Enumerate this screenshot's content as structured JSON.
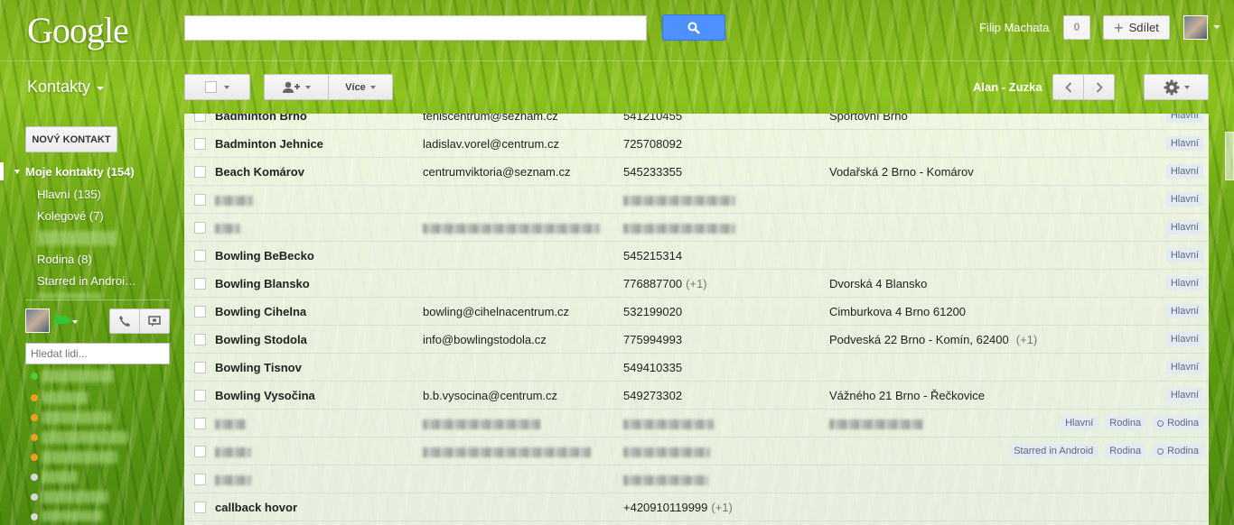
{
  "header": {
    "logo": "Google",
    "user_name": "Filip Machata",
    "notifications": "0",
    "share_label": "Sdílet"
  },
  "app": {
    "title": "Kontakty"
  },
  "toolbar": {
    "more_label": "Více",
    "range_label": "Alan - Zuzka"
  },
  "sidebar": {
    "new_contact": "NOVÝ KONTAKT",
    "my_contacts": "Moje kontakty (154)",
    "groups": [
      "Hlavní (135)",
      "Kolegové (7)",
      "Rodina (8)",
      "Starred in Androi…"
    ],
    "people_search_placeholder": "Hledat lidi..."
  },
  "contacts": [
    {
      "name": "Badminton Brno",
      "email": "teniscentrum@seznam.cz",
      "phone": "541210455",
      "phone_extra": "",
      "address": "Sportovní Brno",
      "address_extra": "",
      "tags": [
        "Hlavní"
      ],
      "blurred": false
    },
    {
      "name": "Badminton Jehnice",
      "email": "ladislav.vorel@centrum.cz",
      "phone": "725708092",
      "phone_extra": "",
      "address": "",
      "address_extra": "",
      "tags": [
        "Hlavní"
      ],
      "blurred": false
    },
    {
      "name": "Beach Komárov",
      "email": "centrumviktoria@seznam.cz",
      "phone": "545233355",
      "phone_extra": "",
      "address": "Vodařská 2 Brno - Komárov",
      "address_extra": "",
      "tags": [
        "Hlavní"
      ],
      "blurred": false
    },
    {
      "name": "",
      "email": "",
      "phone": "",
      "phone_extra": "",
      "address": "",
      "address_extra": "",
      "tags": [
        "Hlavní"
      ],
      "blurred": true,
      "blur": {
        "name": 42,
        "email": 0,
        "phone": 124,
        "addr": 0
      }
    },
    {
      "name": "",
      "email": "",
      "phone": "",
      "phone_extra": "",
      "address": "",
      "address_extra": "",
      "tags": [
        "Hlavní"
      ],
      "blurred": true,
      "blur": {
        "name": 28,
        "email": 196,
        "phone": 124,
        "addr": 0
      }
    },
    {
      "name": "Bowling BeBecko",
      "email": "",
      "phone": "545215314",
      "phone_extra": "",
      "address": "",
      "address_extra": "",
      "tags": [
        "Hlavní"
      ],
      "blurred": false
    },
    {
      "name": "Bowling Blansko",
      "email": "",
      "phone": "776887700",
      "phone_extra": "(+1)",
      "address": "Dvorská 4 Blansko",
      "address_extra": "",
      "tags": [
        "Hlavní"
      ],
      "blurred": false
    },
    {
      "name": "Bowling Cihelna",
      "email": "bowling@cihelnacentrum.cz",
      "phone": "532199020",
      "phone_extra": "",
      "address": "Cimburkova 4 Brno 61200",
      "address_extra": "",
      "tags": [
        "Hlavní"
      ],
      "blurred": false
    },
    {
      "name": "Bowling Stodola",
      "email": "info@bowlingstodola.cz",
      "phone": "775994993",
      "phone_extra": "",
      "address": "Podveská 22 Brno - Komín, 62400",
      "address_extra": "(+1)",
      "tags": [
        "Hlavní"
      ],
      "blurred": false
    },
    {
      "name": "Bowling Tisnov",
      "email": "",
      "phone": "549410335",
      "phone_extra": "",
      "address": "",
      "address_extra": "",
      "tags": [
        "Hlavní"
      ],
      "blurred": false
    },
    {
      "name": "Bowling Vysočina",
      "email": "b.b.vysocina@centrum.cz",
      "phone": "549273302",
      "phone_extra": "",
      "address": "Vážného 21 Brno - Řečkovice",
      "address_extra": "",
      "tags": [
        "Hlavní"
      ],
      "blurred": false
    },
    {
      "name": "",
      "email": "",
      "phone": "",
      "phone_extra": "",
      "address": "",
      "address_extra": "",
      "tags": [
        "Hlavní",
        "Rodina",
        "◯Rodina"
      ],
      "blurred": true,
      "blur": {
        "name": 34,
        "email": 130,
        "phone": 100,
        "addr": 104
      }
    },
    {
      "name": "",
      "email": "",
      "phone": "",
      "phone_extra": "",
      "address": "",
      "address_extra": "",
      "tags": [
        "Starred in Android",
        "Rodina",
        "◯Rodina"
      ],
      "blurred": true,
      "blur": {
        "name": 40,
        "email": 186,
        "phone": 96,
        "addr": 0
      }
    },
    {
      "name": "",
      "email": "",
      "phone": "",
      "phone_extra": "",
      "address": "",
      "address_extra": "",
      "tags": [],
      "blurred": true,
      "blur": {
        "name": 40,
        "email": 0,
        "phone": 94,
        "addr": 0
      }
    },
    {
      "name": "callback hovor",
      "email": "",
      "phone": "+420910119999",
      "phone_extra": "(+1)",
      "address": "",
      "address_extra": "",
      "tags": [],
      "blurred": false
    }
  ]
}
